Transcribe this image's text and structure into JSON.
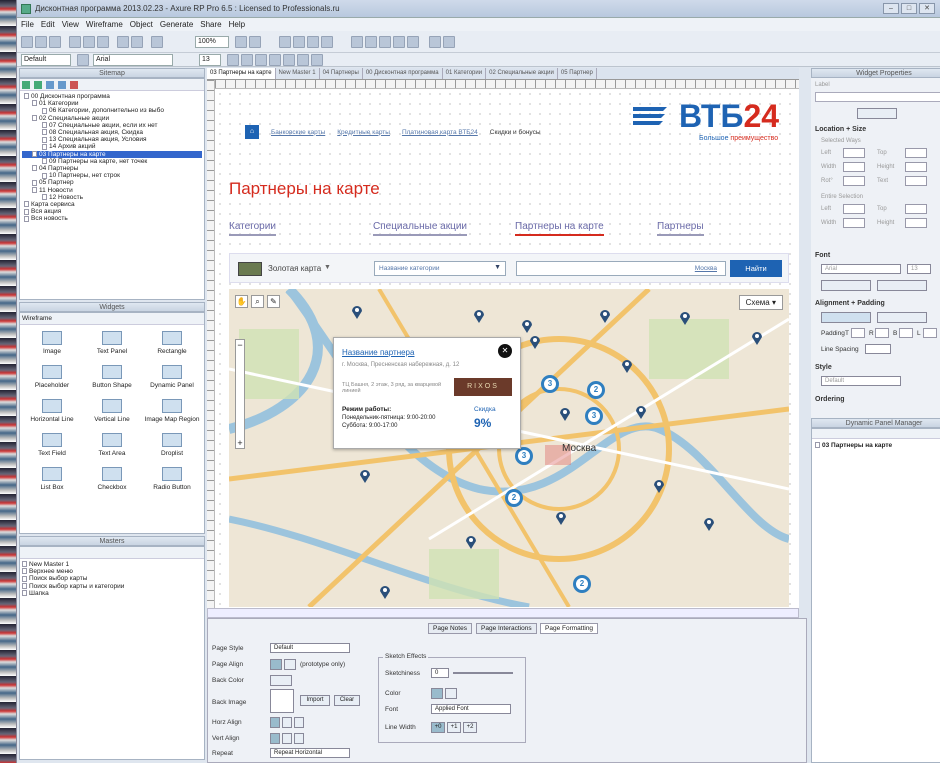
{
  "window": {
    "title": "Дисконтная программа 2013.02.23 - Axure RP Pro 6.5 : Licensed to Professionals.ru"
  },
  "menu": [
    "File",
    "Edit",
    "View",
    "Wireframe",
    "Object",
    "Generate",
    "Share",
    "Help"
  ],
  "toolbar": {
    "zoom": "100%",
    "style": "Default",
    "font": "Arial",
    "size": "13"
  },
  "sitemap": {
    "title": "Sitemap",
    "items": [
      "00 Дисконтная программа",
      "01 Категории",
      "06 Категории, дополнительно из выбо",
      "02 Специальные акции",
      "07 Специальные акции, если их нет",
      "08 Специальная акция, Скидка",
      "13 Специальная акция, Условия",
      "14 Архив акций",
      "03 Партнеры на карте",
      "09 Партнеры на карте, нет точек",
      "04 Партнеры",
      "10 Партнеры, нет строк",
      "05 Партнер",
      "11 Новости",
      "12 Новость",
      "Карта сервиса",
      "Вся акция",
      "Вся новость"
    ]
  },
  "widgets": {
    "title": "Widgets",
    "library": "Wireframe",
    "items": [
      "Image",
      "Text Panel",
      "Rectangle",
      "Placeholder",
      "Button Shape",
      "Dynamic Panel",
      "Horizontal Line",
      "Vertical Line",
      "Image Map Region",
      "Text Field",
      "Text Area",
      "Droplist",
      "List Box",
      "Checkbox",
      "Radio Button"
    ]
  },
  "masters": {
    "title": "Masters",
    "items": [
      "New Master 1",
      "Верхнее меню",
      "Поиск выбор карты",
      "Поиск выбор карты и категории",
      "Шапка"
    ]
  },
  "tabs": [
    "03 Партнеры на карте",
    "New Master 1",
    "04 Партнеры",
    "00 Дисконтная программа",
    "01 Категории",
    "02 Специальные акции",
    "05 Партнер"
  ],
  "page": {
    "breadcrumbs": [
      "Банковские карты",
      "Кредитные карты",
      "Платиновая карта ВТБ24",
      "Скидки и бонусы"
    ],
    "logo_text": "ВТБ",
    "logo_num": "24",
    "slogan_a": "Большое ",
    "slogan_b": "преимущество",
    "heading": "Партнеры на карте",
    "nav": [
      "Категории",
      "Специальные акции",
      "Партнеры на карте",
      "Партнеры"
    ],
    "card_label": "Золотая карта",
    "category_placeholder": "Название категории",
    "search_link": "Москва",
    "search_button": "Найти",
    "map_mode": "Схема",
    "city": "Москва",
    "popup": {
      "title": "Название партнера",
      "address": "г. Москва, Пресненская набережная, д. 12",
      "mall": "ТЦ Башня, 2 этаж, 3 ряд, за кварцевой линией",
      "brand": "RIXOS",
      "hours_label": "Режим работы:",
      "hours_1": "Понедельник-пятница: 9:00-20:00",
      "hours_2": "Суббота: 9:00-17:00",
      "discount_label": "Скидка",
      "discount": "9%"
    },
    "clusters": [
      "3",
      "2",
      "3",
      "3",
      "2",
      "2"
    ]
  },
  "bottom": {
    "tabs": [
      "Page Notes",
      "Page Interactions",
      "Page Formatting"
    ],
    "page_style_label": "Page Style",
    "page_style": "Default",
    "page_align_label": "Page Align",
    "prototype_only": "(prototype only)",
    "back_color_label": "Back Color",
    "back_image_label": "Back Image",
    "import": "Import",
    "clear": "Clear",
    "horz_align_label": "Horz Align",
    "vert_align_label": "Vert Align",
    "repeat_label": "Repeat",
    "repeat": "Repeat Horizontal",
    "sketch_title": "Sketch Effects",
    "sketchiness_label": "Sketchiness",
    "sketchiness": "0",
    "color_label": "Color",
    "font_label": "Font",
    "font": "Applied Font",
    "line_width_label": "Line Width",
    "lw": [
      "+0",
      "+1",
      "+2"
    ]
  },
  "properties": {
    "title": "Widget Properties",
    "label_field": "Label",
    "location_size": "Location + Size",
    "selected_ways": "Selected Ways",
    "entire_selection": "Entire Selection",
    "left": "Left",
    "top": "Top",
    "width": "Width",
    "height": "Height",
    "rot": "Rot°",
    "text": "Text",
    "font": "Font",
    "font_name": "Arial",
    "font_size": "13",
    "alignment": "Alignment + Padding",
    "padding": "Padding",
    "pad_t": "T",
    "pad_r": "R",
    "pad_b": "B",
    "pad_l": "L",
    "line_spacing": "Line Spacing",
    "style": "Style",
    "style_value": "Default",
    "ordering": "Ordering",
    "dpm_title": "Dynamic Panel Manager",
    "dpm_item": "03 Партнеры на карте"
  },
  "colors": {
    "accent": "#1e63b3",
    "vtb_red": "#d52b1e",
    "heading_red": "#d52b1e",
    "cluster": "#2f7fc0",
    "selection": "#3366cc"
  }
}
